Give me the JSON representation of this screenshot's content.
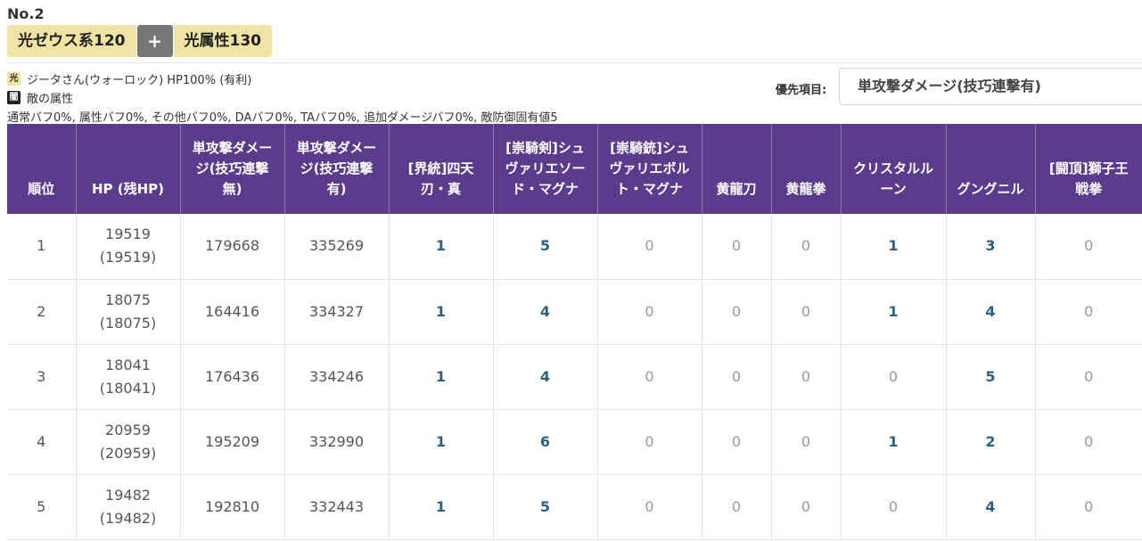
{
  "no_label": "No.2",
  "chips": {
    "chip1": "光ゼウス系120",
    "plus": "+",
    "chip2": "光属性130"
  },
  "info": {
    "char_badge": "光",
    "char_text": "ジータさん(ウォーロック) HP100% (有利)",
    "enemy_badge": "闇",
    "enemy_text": "敵の属性",
    "buff_line": "通常バフ0%, 属性バフ0%, その他バフ0%, DAバフ0%, TAバフ0%, 追加ダメージバフ0%, 敵防御固有値5"
  },
  "priority": {
    "label": "優先項目:",
    "value": "単攻撃ダメージ(技巧連撃有)"
  },
  "table": {
    "headers": [
      "順位",
      "HP (残HP)",
      "単攻撃ダメージ(技巧連撃無)",
      "単攻撃ダメージ(技巧連撃有)",
      "[界統]四天刃・真",
      "[崇騎剣]シュヴァリエソード・マグナ",
      "[崇騎銃]シュヴァリエボルト・マグナ",
      "黄龍刀",
      "黄龍拳",
      "クリスタルルーン",
      "グングニル",
      "[闘頂]獅子王戦拳"
    ],
    "rows": [
      {
        "rank": "1",
        "hp": "19519",
        "hp_rem": "(19519)",
        "dmg_no": "179668",
        "dmg_yes": "335269",
        "w": [
          "1",
          "5",
          "0",
          "0",
          "0",
          "1",
          "3",
          "0"
        ]
      },
      {
        "rank": "2",
        "hp": "18075",
        "hp_rem": "(18075)",
        "dmg_no": "164416",
        "dmg_yes": "334327",
        "w": [
          "1",
          "4",
          "0",
          "0",
          "0",
          "1",
          "4",
          "0"
        ]
      },
      {
        "rank": "3",
        "hp": "18041",
        "hp_rem": "(18041)",
        "dmg_no": "176436",
        "dmg_yes": "334246",
        "w": [
          "1",
          "4",
          "0",
          "0",
          "0",
          "0",
          "5",
          "0"
        ]
      },
      {
        "rank": "4",
        "hp": "20959",
        "hp_rem": "(20959)",
        "dmg_no": "195209",
        "dmg_yes": "332990",
        "w": [
          "1",
          "6",
          "0",
          "0",
          "0",
          "1",
          "2",
          "0"
        ]
      },
      {
        "rank": "5",
        "hp": "19482",
        "hp_rem": "(19482)",
        "dmg_no": "192810",
        "dmg_yes": "332443",
        "w": [
          "1",
          "5",
          "0",
          "0",
          "0",
          "0",
          "4",
          "0"
        ]
      }
    ]
  }
}
